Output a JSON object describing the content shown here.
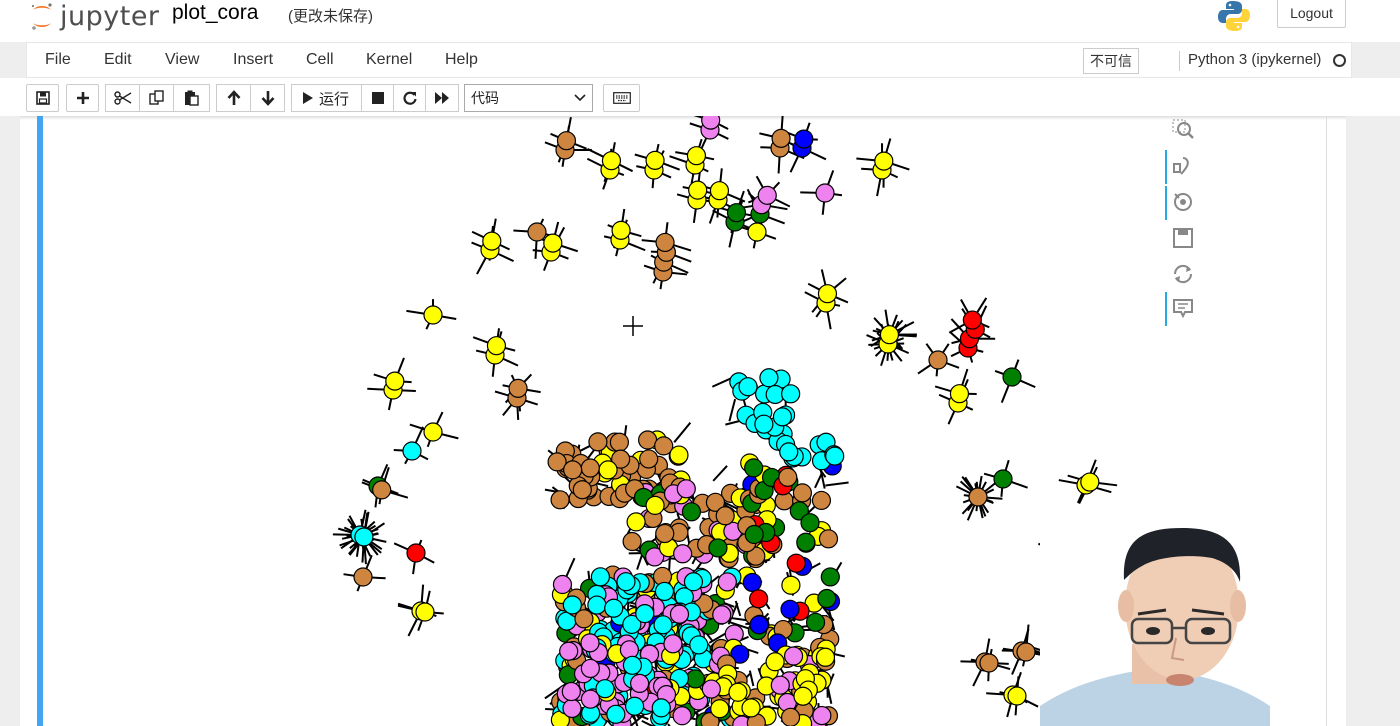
{
  "header": {
    "logo_text": "jupyter",
    "notebook_name": "plot_cora",
    "save_status": "(更改未保存)",
    "logout_label": "Logout"
  },
  "menu": {
    "items": [
      "File",
      "Edit",
      "View",
      "Insert",
      "Cell",
      "Kernel",
      "Help"
    ],
    "trusted_label": "不可信",
    "kernel_name": "Python 3 (ipykernel)"
  },
  "toolbar": {
    "run_label": "运行",
    "cell_type_selected": "代码"
  },
  "icons": {
    "save": "save-icon",
    "add": "plus-icon",
    "cut": "scissors-icon",
    "copy": "copy-icon",
    "paste": "paste-icon",
    "up": "arrow-up-icon",
    "down": "arrow-down-icon",
    "run": "play-icon",
    "stop": "stop-icon",
    "restart": "restart-icon",
    "fast_forward": "fast-forward-icon",
    "keyboard": "keyboard-icon",
    "zoom": "zoom-icon",
    "pan": "pan-icon",
    "wheel_zoom": "wheel-zoom-icon",
    "save_plot": "save-plot-icon",
    "reset": "reset-icon",
    "hover": "hover-icon"
  },
  "colors": {
    "cell_bar": "#42a5f5",
    "node_palette": [
      "#ffff00",
      "#cd853f",
      "#00ffff",
      "#ee82ee",
      "#008000",
      "#ff0000",
      "#0000ff"
    ]
  }
}
